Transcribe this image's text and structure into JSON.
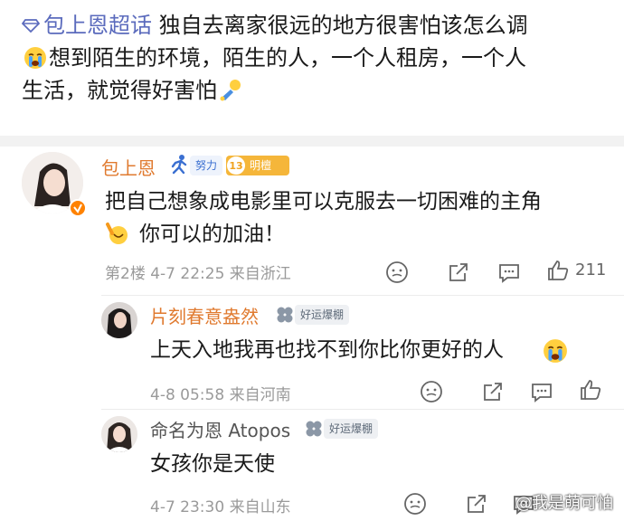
{
  "post": {
    "topic": "包上恩超话",
    "line1_text": "独自去离家很远的地方很害怕该怎么调",
    "line2_text": "想到陌生的环境，陌生的人，一个人租房，一个人",
    "line3_text": "生活，就觉得好害怕"
  },
  "comments": [
    {
      "username": "包上恩",
      "level_badge": "努力",
      "fan_level": "13",
      "fan_badge": "明檀",
      "line1": "把自己想象成电影里可以克服去一切困难的主角",
      "line2": "你可以的加油！",
      "meta": "第2楼  4-7  22:25  来自浙江",
      "likes": "211"
    },
    {
      "username": "片刻春意盎然",
      "badge": "好运爆棚",
      "line1": "上天入地我再也找不到你比你更好的人",
      "meta": "4-8  05:58  来自河南"
    },
    {
      "username": "命名为恩 Atopos",
      "badge": "好运爆棚",
      "line1": "女孩你是天使",
      "meta": "4-7  23:30  来自山东"
    }
  ],
  "watermark": "@我是萌可怕"
}
